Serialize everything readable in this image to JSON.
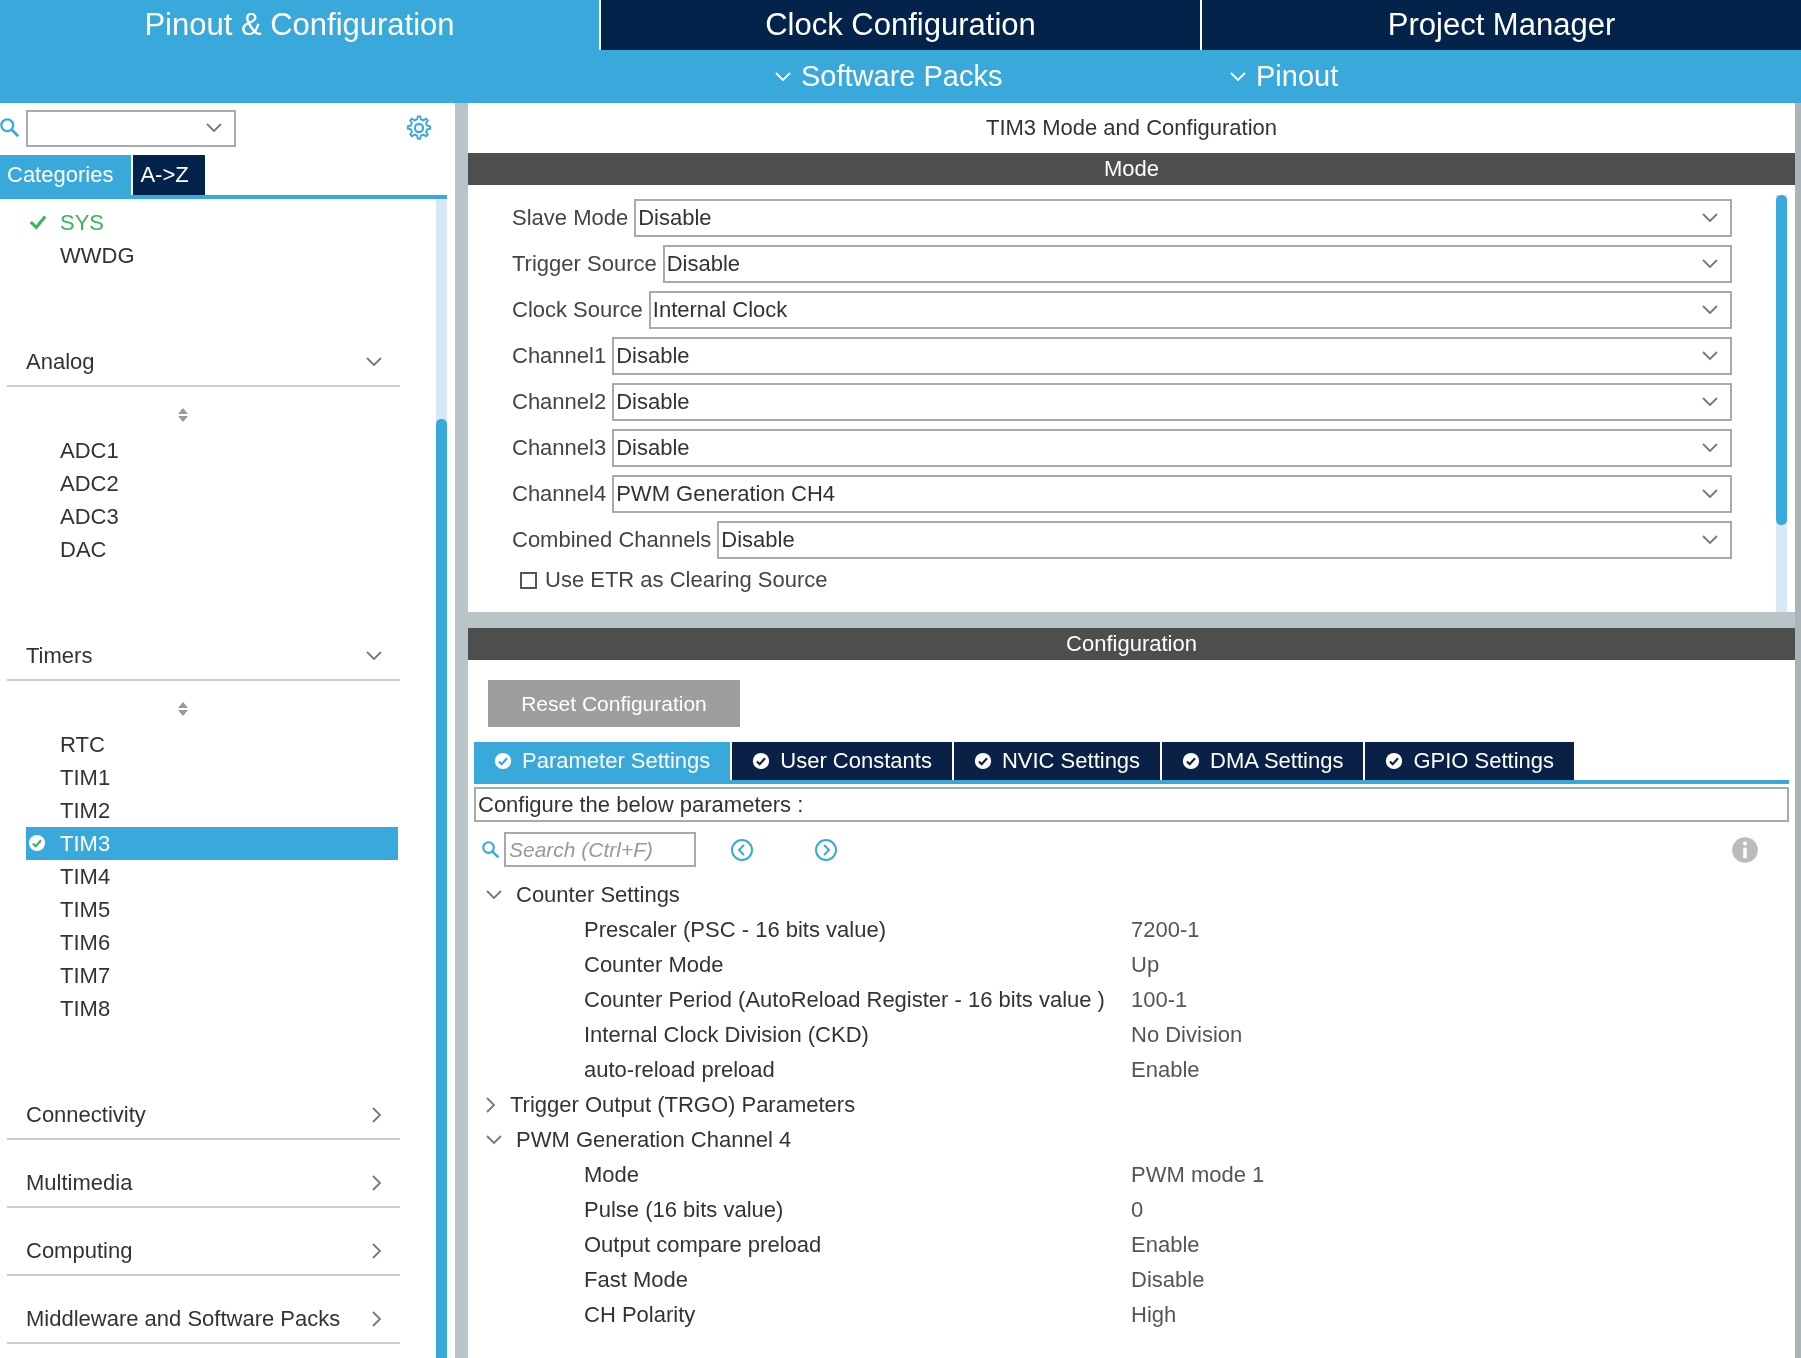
{
  "header": {
    "tabs": [
      {
        "label": "Pinout & Configuration",
        "selected": true
      },
      {
        "label": "Clock Configuration",
        "selected": false
      },
      {
        "label": "Project Manager",
        "selected": false
      }
    ],
    "menus": [
      {
        "label": "Software Packs"
      },
      {
        "label": "Pinout"
      }
    ]
  },
  "sidebar": {
    "view_tabs": [
      {
        "label": "Categories",
        "selected": true
      },
      {
        "label": "A->Z",
        "selected": false
      }
    ],
    "items": [
      {
        "label": "SYS",
        "checked": true,
        "selected": false
      },
      {
        "label": "WWDG",
        "checked": false,
        "selected": false
      }
    ],
    "groups": [
      {
        "label": "Analog",
        "expanded": true,
        "children": [
          {
            "label": "ADC1",
            "checked": false,
            "selected": false
          },
          {
            "label": "ADC2",
            "checked": false,
            "selected": false
          },
          {
            "label": "ADC3",
            "checked": false,
            "selected": false
          },
          {
            "label": "DAC",
            "checked": false,
            "selected": false
          }
        ]
      },
      {
        "label": "Timers",
        "expanded": true,
        "children": [
          {
            "label": "RTC",
            "checked": false,
            "selected": false
          },
          {
            "label": "TIM1",
            "checked": false,
            "selected": false
          },
          {
            "label": "TIM2",
            "checked": false,
            "selected": false
          },
          {
            "label": "TIM3",
            "checked": true,
            "selected": true
          },
          {
            "label": "TIM4",
            "checked": false,
            "selected": false
          },
          {
            "label": "TIM5",
            "checked": false,
            "selected": false
          },
          {
            "label": "TIM6",
            "checked": false,
            "selected": false
          },
          {
            "label": "TIM7",
            "checked": false,
            "selected": false
          },
          {
            "label": "TIM8",
            "checked": false,
            "selected": false
          }
        ]
      },
      {
        "label": "Connectivity",
        "expanded": false
      },
      {
        "label": "Multimedia",
        "expanded": false
      },
      {
        "label": "Computing",
        "expanded": false
      },
      {
        "label": "Middleware and Software Packs",
        "expanded": false
      }
    ]
  },
  "main": {
    "title": "TIM3 Mode and Configuration",
    "mode": {
      "header": "Mode",
      "fields": [
        {
          "label": "Slave Mode",
          "value": "Disable"
        },
        {
          "label": "Trigger Source",
          "value": "Disable"
        },
        {
          "label": "Clock Source",
          "value": "Internal Clock"
        },
        {
          "label": "Channel1",
          "value": "Disable"
        },
        {
          "label": "Channel2",
          "value": "Disable"
        },
        {
          "label": "Channel3",
          "value": "Disable"
        },
        {
          "label": "Channel4",
          "value": "PWM Generation CH4"
        },
        {
          "label": "Combined Channels",
          "value": "Disable"
        }
      ],
      "checkbox": {
        "label": "Use ETR as Clearing Source",
        "checked": false
      }
    },
    "configuration": {
      "header": "Configuration",
      "reset_button": "Reset Configuration",
      "tabs": [
        {
          "label": "Parameter Settings",
          "selected": true
        },
        {
          "label": "User Constants",
          "selected": false
        },
        {
          "label": "NVIC Settings",
          "selected": false
        },
        {
          "label": "DMA Settings",
          "selected": false
        },
        {
          "label": "GPIO Settings",
          "selected": false
        }
      ],
      "description": "Configure the below parameters :",
      "search": {
        "placeholder": "Search (Ctrl+F)"
      },
      "tree": [
        {
          "label": "Counter Settings",
          "expanded": true,
          "children": [
            {
              "label": "Prescaler (PSC - 16 bits value)",
              "value": "7200-1"
            },
            {
              "label": "Counter Mode",
              "value": "Up"
            },
            {
              "label": "Counter Period (AutoReload Register - 16 bits value )",
              "value": "100-1"
            },
            {
              "label": "Internal Clock Division (CKD)",
              "value": "No Division"
            },
            {
              "label": "auto-reload preload",
              "value": "Enable"
            }
          ]
        },
        {
          "label": "Trigger Output (TRGO) Parameters",
          "expanded": false
        },
        {
          "label": "PWM Generation Channel 4",
          "expanded": true,
          "children": [
            {
              "label": "Mode",
              "value": "PWM mode 1"
            },
            {
              "label": "Pulse (16 bits value)",
              "value": "0"
            },
            {
              "label": "Output compare preload",
              "value": "Enable"
            },
            {
              "label": "Fast Mode",
              "value": "Disable"
            },
            {
              "label": "CH Polarity",
              "value": "High"
            }
          ]
        }
      ]
    }
  }
}
